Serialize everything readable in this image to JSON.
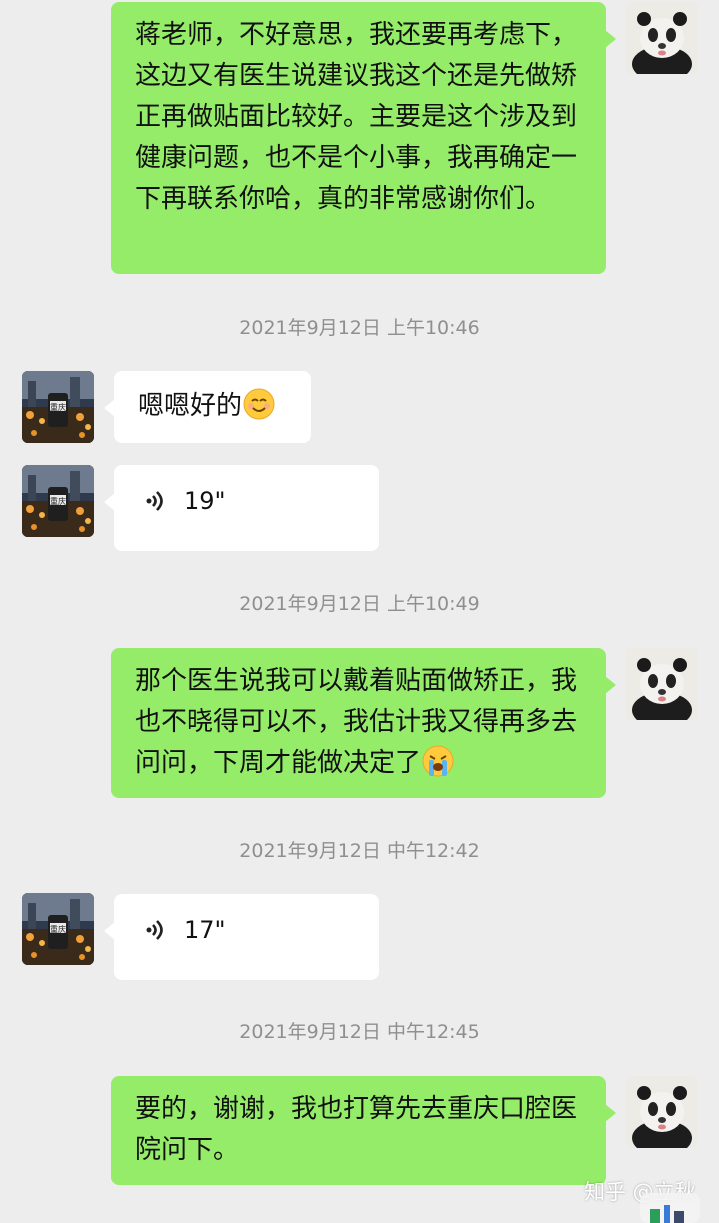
{
  "messages": {
    "m1": {
      "text": "蒋老师，不好意思，我还要再考虑下，这边又有医生说建议我这个还是先做矫正再做贴面比较好。主要是这个涉及到健康问题，也不是个小事，我再确定一下再联系你哈，真的非常感谢你们。"
    },
    "ts1": "2021年9月12日 上午10:46",
    "m2": {
      "text": "嗯嗯好的",
      "emoji": "smiling-face-emoji"
    },
    "m3": {
      "duration": "19\""
    },
    "ts2": "2021年9月12日 上午10:49",
    "m4": {
      "text": "那个医生说我可以戴着贴面做矫正，我也不晓得可以不，我估计我又得再多去问问，下周才能做决定了",
      "emoji": "crying-face-emoji"
    },
    "ts3": "2021年9月12日 中午12:42",
    "m5": {
      "duration": "17\""
    },
    "ts4": "2021年9月12日 中午12:45",
    "m6": {
      "text": "要的，谢谢，我也打算先去重庆口腔医院问下。"
    }
  },
  "watermark": "知乎 @立秋",
  "colors": {
    "outgoing_bubble": "#95ec69",
    "incoming_bubble": "#ffffff",
    "background": "#ededed",
    "timestamp": "#8f8f8f"
  }
}
